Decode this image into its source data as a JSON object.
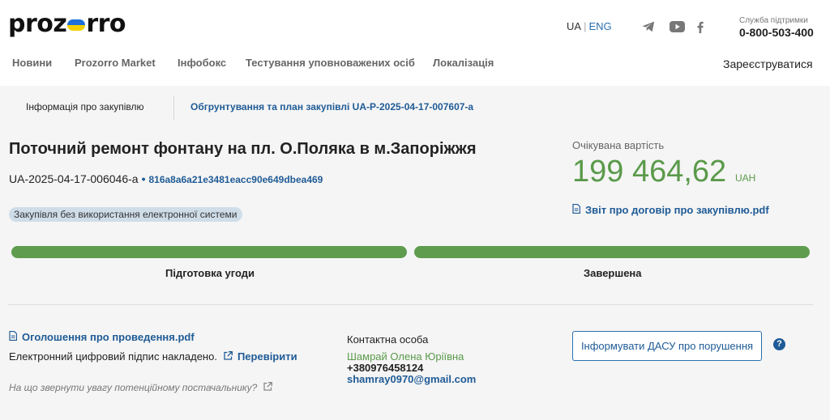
{
  "header": {
    "logo_left": "proz",
    "logo_right": "rro",
    "lang_ua": "UA",
    "lang_sep": "|",
    "lang_eng": "ENG",
    "support_label": "Служба підтримки",
    "support_phone": "0-800-503-400",
    "social_icons": [
      "telegram-icon",
      "youtube-icon",
      "facebook-icon"
    ],
    "nav": [
      "Новини",
      "Prozorro Market",
      "Інфобокс",
      "Тестування уповноважених осіб",
      "Локалізація"
    ],
    "register": "Зареєструватися"
  },
  "tabs": {
    "info": "Інформація про закупівлю",
    "plan": "Обгрунтування та план закупівлі UA-P-2025-04-17-007607-a"
  },
  "tender": {
    "title": "Поточний ремонт фонтану на пл. О.Поляка в м.Запоріжжя",
    "id": "UA-2025-04-17-006046-a",
    "dot": "•",
    "hash": "816a8a6a21e3481eacc90e649dbea469",
    "badge": "Закупівля без використання електронної системи",
    "value_label": "Очікувана вартість",
    "value": "199 464,62",
    "currency": "UAH",
    "report": "Звіт про договір про закупівлю.pdf"
  },
  "stages": {
    "stage1": "Підготовка угоди",
    "stage2": "Завершена",
    "progress_stage1": 1.0,
    "progress_stage2": 1.0
  },
  "docs": {
    "announcement": "Оголошення про проведення.pdf",
    "signature": "Електронний цифровий підпис накладено.",
    "verify": "Перевірити",
    "hint": "На що звернути увагу потенційному постачальнику?"
  },
  "contact": {
    "label": "Контактна особа",
    "name": "Шамрай Олена Юріївна",
    "phone": "+380976458124",
    "email": "shamray0970@gmail.com"
  },
  "actions": {
    "dasu": "Інформувати ДАСУ про порушення",
    "help": "?"
  },
  "colors": {
    "accent_blue": "#1f5b96",
    "green": "#5a9a4a",
    "progress_green": "#5f9c4e",
    "flag_blue": "#1e6fd9",
    "flag_yellow": "#f5d000"
  }
}
